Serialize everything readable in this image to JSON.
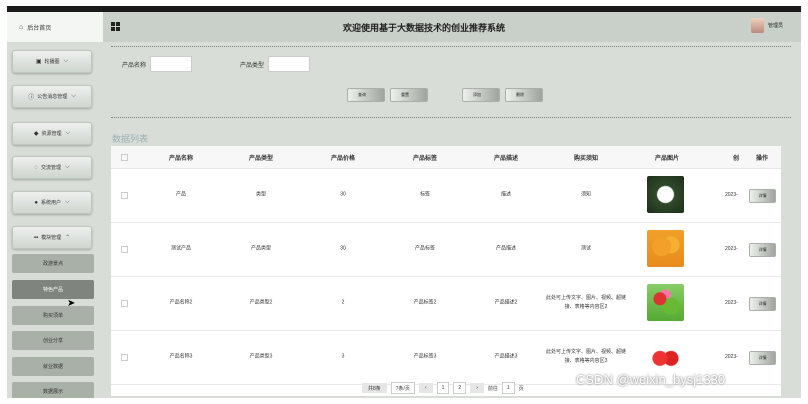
{
  "header": {
    "home_label": "后台首页",
    "title": "欢迎使用基于大数据技术的创业推荐系统",
    "user_label": "管理员"
  },
  "sidebar": {
    "menus": [
      {
        "label": "轮播图",
        "icon": "image-icon"
      },
      {
        "label": "公告消息管理",
        "icon": "info-icon"
      },
      {
        "label": "资源管理",
        "icon": "tag-icon"
      },
      {
        "label": "交流管理",
        "icon": "chat-icon"
      },
      {
        "label": "系统用户",
        "icon": "user-icon"
      },
      {
        "label": "模块管理",
        "icon": "grid-icon"
      }
    ],
    "submenu": [
      "政游景点",
      "特色产品",
      "购买须单",
      "创业分享",
      "就业数据",
      "数据展示"
    ],
    "active_submenu_index": 1
  },
  "search": {
    "name_label": "产品名称",
    "type_label": "产品类型",
    "buttons": {
      "query": "查询",
      "reset": "重置",
      "add": "添加",
      "delete": "删除"
    }
  },
  "section_title": "数据列表",
  "table": {
    "columns": [
      "产品名称",
      "产品类型",
      "产品价格",
      "产品标签",
      "产品描述",
      "购买须知",
      "产品图片",
      "创",
      "操作"
    ],
    "rows": [
      {
        "name": "产品",
        "type": "类型",
        "price": "30",
        "tag": "标签",
        "desc": "描述",
        "notice": "须知",
        "image": "lotus",
        "date": "2023-",
        "action": "详情"
      },
      {
        "name": "测试产品",
        "type": "产品类型",
        "price": "30",
        "tag": "产品标签",
        "desc": "产品描述",
        "notice": "测试",
        "image": "orange",
        "date": "2023-",
        "action": "详情"
      },
      {
        "name": "产品名称2",
        "type": "产品类型2",
        "price": "2",
        "tag": "产品标签2",
        "desc": "产品描述2",
        "notice": "此处可上传文字、图片、视频、超链接、表格等内容区2",
        "image": "vegetables",
        "date": "2023-",
        "action": "详情"
      },
      {
        "name": "产品名称3",
        "type": "产品类型3",
        "price": "3",
        "tag": "产品标签3",
        "desc": "产品描述3",
        "notice": "此处可上传文字、图片、视频、超链接、表格等内容区3",
        "image": "apples",
        "date": "2023-",
        "action": "详情"
      }
    ]
  },
  "pagination": {
    "total_label": "共8条",
    "page_size": "7条/页",
    "prev": "‹",
    "pages": [
      "1",
      "2"
    ],
    "next": "›",
    "goto_label": "前往",
    "goto_value": "1",
    "page_unit": "页"
  },
  "watermark": "CSDN @weixin_bysj1330"
}
